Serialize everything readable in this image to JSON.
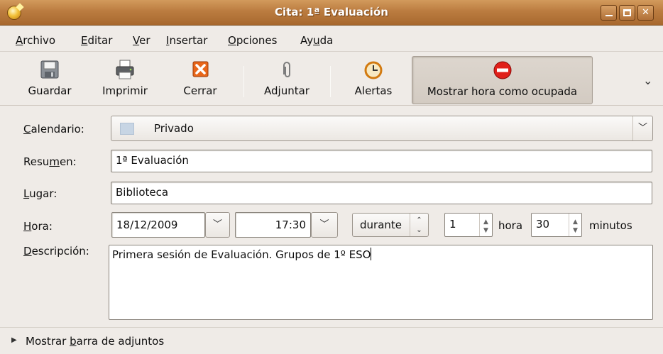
{
  "window": {
    "title": "Cita: 1ª Evaluación"
  },
  "menu": [
    {
      "first": "A",
      "rest": "rchivo"
    },
    {
      "first": "E",
      "rest": "ditar"
    },
    {
      "first": "V",
      "rest": "er"
    },
    {
      "first": "I",
      "rest": "nsertar"
    },
    {
      "first": "O",
      "rest": "pciones"
    },
    {
      "pre": "Ay",
      "first": "u",
      "rest": "da"
    }
  ],
  "toolbar": {
    "save": "Guardar",
    "print": "Imprimir",
    "close": "Cerrar",
    "attach": "Adjuntar",
    "alarms": "Alertas",
    "busy": "Mostrar hora como ocupada"
  },
  "form": {
    "calendar_label_first": "C",
    "calendar_label_rest": "alendario:",
    "calendar_value": "Privado",
    "summary_label_pre": "Resu",
    "summary_label_first": "m",
    "summary_label_rest": "en:",
    "summary_value": "1ª Evaluación",
    "location_label_first": "L",
    "location_label_rest": "ugar:",
    "location_value": "Biblioteca",
    "time_label_first": "H",
    "time_label_rest": "ora:",
    "date_value": "18/12/2009",
    "time_value": "17:30",
    "duration_mode": "durante",
    "hours_value": "1",
    "hours_unit": "hora",
    "minutes_value": "30",
    "minutes_unit": "minutos",
    "description_label_first": "D",
    "description_label_rest": "escripción:",
    "description_value": "Primera sesión de Evaluación. Grupos de 1º ESO"
  },
  "attachments": {
    "pre": "Mostrar ",
    "first": "b",
    "rest": "arra de adjuntos"
  },
  "colors": {
    "titlebar": "#bb7c40",
    "busy_icon": "#e0201a",
    "calendar_chip": "#c7d5e4"
  }
}
